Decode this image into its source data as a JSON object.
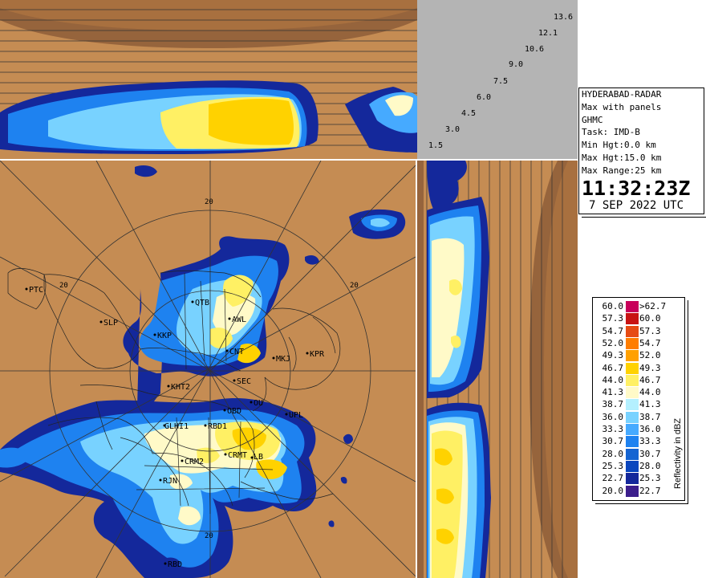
{
  "station": {
    "name": "HYDERABAD-RADAR",
    "product": "Max with panels",
    "area": "GHMC",
    "task": "Task: IMD-B",
    "min_height": "Min Hgt:0.0 km",
    "max_height": "Max Hgt:15.0 km",
    "max_range": "Max Range:25 km",
    "time": "11:32:23Z",
    "date": "7 SEP 2022 UTC"
  },
  "elevation_angles": [
    "1.5",
    "3.0",
    "4.5",
    "6.0",
    "7.5",
    "9.0",
    "10.6",
    "12.1",
    "13.6"
  ],
  "range_ring_labels": [
    "20",
    "20",
    "20",
    "20"
  ],
  "places": [
    "PTC",
    "SLP",
    "KKP",
    "QTB",
    "AWL",
    "CNT",
    "MKJ",
    "KPR",
    "SEC",
    "KHT2",
    "OBD",
    "OU",
    "UPL",
    "GLHI1",
    "RBD1",
    "CRM2",
    "CRMT",
    "LB",
    "RJN",
    "RBD"
  ],
  "legend": {
    "title": "Reflectivity in dBZ",
    "rows": [
      {
        "lo": "60.0",
        "hi": ">62.7",
        "color": "#c8005a"
      },
      {
        "lo": "57.3",
        "hi": "60.0",
        "color": "#c81414"
      },
      {
        "lo": "54.7",
        "hi": "57.3",
        "color": "#e64b14"
      },
      {
        "lo": "52.0",
        "hi": "54.7",
        "color": "#ff7d00"
      },
      {
        "lo": "49.3",
        "hi": "52.0",
        "color": "#ffa000"
      },
      {
        "lo": "46.7",
        "hi": "49.3",
        "color": "#ffd200"
      },
      {
        "lo": "44.0",
        "hi": "46.7",
        "color": "#fff064"
      },
      {
        "lo": "41.3",
        "hi": "44.0",
        "color": "#fffac8"
      },
      {
        "lo": "38.7",
        "hi": "41.3",
        "color": "#b4f0ff"
      },
      {
        "lo": "36.0",
        "hi": "38.7",
        "color": "#78d2ff"
      },
      {
        "lo": "33.3",
        "hi": "36.0",
        "color": "#46aaff"
      },
      {
        "lo": "30.7",
        "hi": "33.3",
        "color": "#1e82f0"
      },
      {
        "lo": "28.0",
        "hi": "30.7",
        "color": "#1464d2"
      },
      {
        "lo": "25.3",
        "hi": "28.0",
        "color": "#0a46be"
      },
      {
        "lo": "22.7",
        "hi": "25.3",
        "color": "#14289b"
      },
      {
        "lo": "20.0",
        "hi": "22.7",
        "color": "#3c1e8c"
      }
    ]
  },
  "colors": {
    "background": "#c58c53",
    "shadow_zone": "#96643c",
    "scale_panel": "#b4b4b4"
  }
}
